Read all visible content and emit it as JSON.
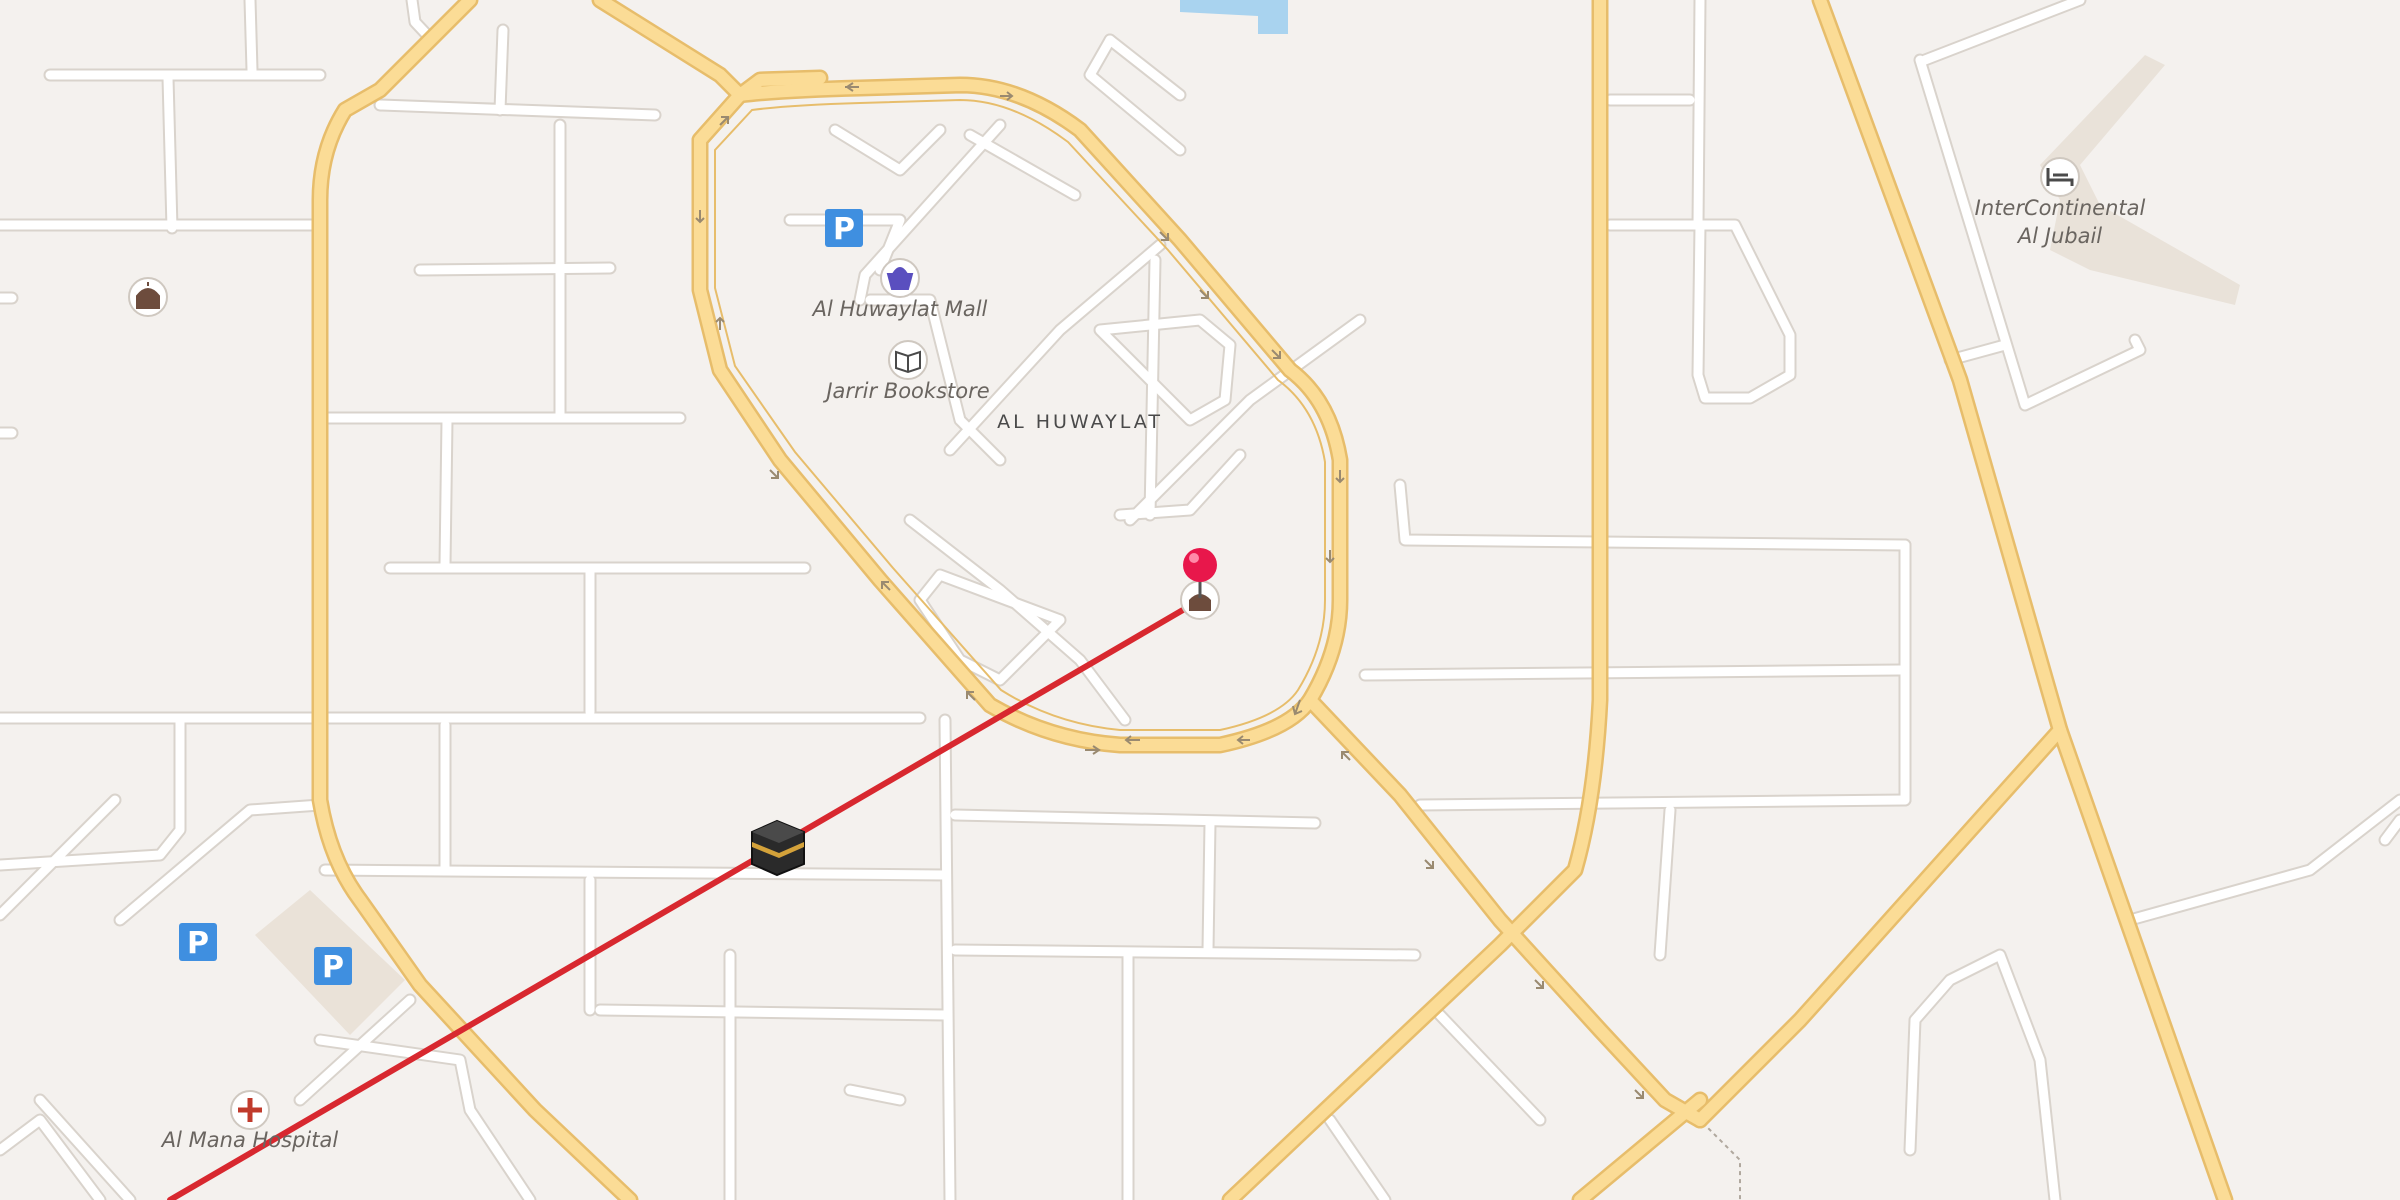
{
  "map": {
    "area_label": "AL HUWAYLAT",
    "pois": {
      "mall": {
        "label": "Al Huwaylat Mall",
        "icon": "shopping-basket-icon"
      },
      "bookstore": {
        "label": "Jarrir Bookstore",
        "icon": "book-icon"
      },
      "hotel": {
        "label_line1": "InterContinental",
        "label_line2": "Al Jubail",
        "icon": "bed-icon"
      },
      "hospital": {
        "label": "Al Mana Hospital",
        "icon": "red-cross-icon"
      },
      "mosque_west": {
        "icon": "mosque-icon"
      },
      "mosque_center": {
        "icon": "mosque-icon"
      }
    },
    "parking_label": "P",
    "markers": {
      "location_pin": {
        "icon": "red-pin-icon",
        "color": "#e8174b"
      },
      "kaaba": {
        "icon": "kaaba-icon"
      }
    },
    "qibla_line": {
      "color": "#d8282f"
    },
    "colors": {
      "background": "#f4f1ee",
      "major_road": "#fbdc96",
      "major_road_edge": "#e7bd6b",
      "minor_road": "#ffffff",
      "minor_road_edge": "#d9d3cc",
      "water": "#a9d3ef",
      "parking": "#3f8fe0",
      "building": "#e9e2d9"
    }
  }
}
